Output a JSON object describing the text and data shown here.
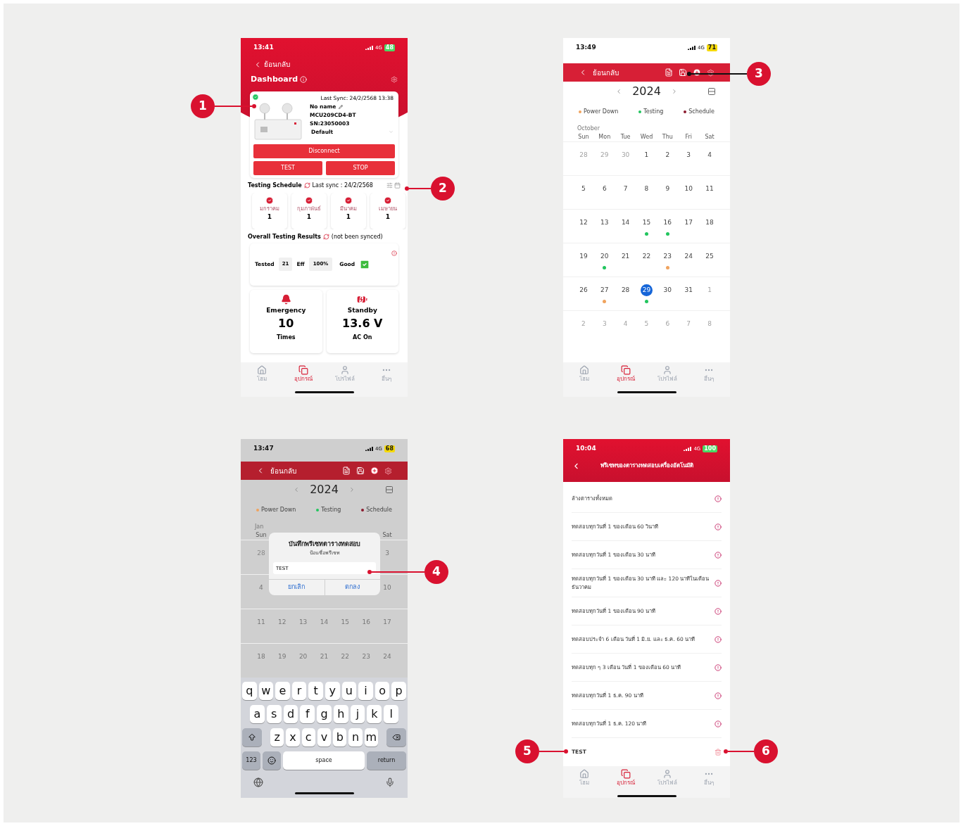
{
  "phones": [
    {
      "kind": "dashboard",
      "status_bar": {
        "time": "13:41",
        "network": "4G",
        "battery": "48",
        "low_power": false
      },
      "back_label": "ย้อนกลับ",
      "title": "Dashboard",
      "device": {
        "connected": true,
        "last_sync": "Last Sync: 24/2/2568 13:38",
        "name": "No name",
        "model": "MCU209CD4-BT",
        "serial": "SN:23050003",
        "preset": "Default"
      },
      "buttons": {
        "disconnect": "Disconnect",
        "test": "TEST",
        "stop": "STOP"
      },
      "schedule": {
        "title": "Testing Schedule",
        "last_sync": "Last sync : 24/2/2568",
        "months": [
          {
            "label": "มกราคม",
            "count": "1"
          },
          {
            "label": "กุมภาพันธ์",
            "count": "1"
          },
          {
            "label": "มีนาคม",
            "count": "1"
          },
          {
            "label": "เมษายน",
            "count": "1"
          }
        ]
      },
      "overall": {
        "title": "Overall Testing Results",
        "sync_status": "(not been synced)",
        "tested_label": "Tested",
        "tested": "21",
        "eff_label": "Eff",
        "eff": "100%",
        "result": "Good"
      },
      "stats": [
        {
          "kind": "emergency",
          "title": "Emergency",
          "value": "10",
          "unit": "Times"
        },
        {
          "kind": "standby",
          "title": "Standby",
          "value": "13.6 V",
          "unit": "AC On"
        }
      ],
      "tab_bar": [
        {
          "label": "โฮม",
          "selected": false
        },
        {
          "label": "อุปกรณ์",
          "selected": true
        },
        {
          "label": "โปรไฟล์",
          "selected": false
        },
        {
          "label": "อื่นๆ",
          "selected": false
        }
      ]
    },
    {
      "kind": "calendar",
      "status_bar": {
        "time": "13:49",
        "network": "4G",
        "battery": "71",
        "low_power": true
      },
      "back_label": "ย้อนกลับ",
      "year": "2024",
      "legend": [
        {
          "label": "Power Down",
          "color": "#f0a35e"
        },
        {
          "label": "Testing",
          "color": "#22c55e"
        },
        {
          "label": "Schedule",
          "color": "#8b1a2e"
        }
      ],
      "month": "October",
      "weekdays": [
        "Sun",
        "Mon",
        "Tue",
        "Wed",
        "Thu",
        "Fri",
        "Sat"
      ],
      "weeks": [
        [
          {
            "day": "28",
            "muted": true,
            "selected": false
          },
          {
            "day": "29",
            "muted": true,
            "selected": false
          },
          {
            "day": "30",
            "muted": true,
            "selected": false
          },
          {
            "day": "1",
            "muted": false,
            "selected": false
          },
          {
            "day": "2",
            "muted": false,
            "selected": false
          },
          {
            "day": "3",
            "muted": false,
            "selected": false
          },
          {
            "day": "4",
            "muted": false,
            "selected": false
          }
        ],
        [
          {
            "day": "5",
            "muted": false,
            "selected": false
          },
          {
            "day": "6",
            "muted": false,
            "selected": false
          },
          {
            "day": "7",
            "muted": false,
            "selected": false
          },
          {
            "day": "8",
            "muted": false,
            "selected": false
          },
          {
            "day": "9",
            "muted": false,
            "selected": false
          },
          {
            "day": "10",
            "muted": false,
            "selected": false
          },
          {
            "day": "11",
            "muted": false,
            "selected": false
          }
        ],
        [
          {
            "day": "12",
            "muted": false,
            "selected": false
          },
          {
            "day": "13",
            "muted": false,
            "selected": false
          },
          {
            "day": "14",
            "muted": false,
            "selected": false
          },
          {
            "day": "15",
            "muted": false,
            "selected": false,
            "color": "#22c55e"
          },
          {
            "day": "16",
            "muted": false,
            "selected": false,
            "color": "#22c55e"
          },
          {
            "day": "17",
            "muted": false,
            "selected": false
          },
          {
            "day": "18",
            "muted": false,
            "selected": false
          }
        ],
        [
          {
            "day": "19",
            "muted": false,
            "selected": false
          },
          {
            "day": "20",
            "muted": false,
            "selected": false,
            "color": "#22c55e"
          },
          {
            "day": "21",
            "muted": false,
            "selected": false
          },
          {
            "day": "22",
            "muted": false,
            "selected": false
          },
          {
            "day": "23",
            "muted": false,
            "selected": false,
            "color": "#f0a35e"
          },
          {
            "day": "24",
            "muted": false,
            "selected": false
          },
          {
            "day": "25",
            "muted": false,
            "selected": false
          }
        ],
        [
          {
            "day": "26",
            "muted": false,
            "selected": false
          },
          {
            "day": "27",
            "muted": false,
            "selected": false,
            "color": "#f0a35e"
          },
          {
            "day": "28",
            "muted": false,
            "selected": false
          },
          {
            "day": "29",
            "muted": false,
            "selected": true,
            "color": "#22c55e"
          },
          {
            "day": "30",
            "muted": false,
            "selected": false
          },
          {
            "day": "31",
            "muted": false,
            "selected": false
          },
          {
            "day": "1",
            "muted": true,
            "selected": false
          }
        ],
        [
          {
            "day": "2",
            "muted": true,
            "selected": false
          },
          {
            "day": "3",
            "muted": true,
            "selected": false
          },
          {
            "day": "4",
            "muted": true,
            "selected": false
          },
          {
            "day": "5",
            "muted": true,
            "selected": false
          },
          {
            "day": "6",
            "muted": true,
            "selected": false
          },
          {
            "day": "7",
            "muted": true,
            "selected": false
          },
          {
            "day": "8",
            "muted": true,
            "selected": false
          }
        ]
      ],
      "tab_bar": [
        {
          "label": "โฮม",
          "selected": false
        },
        {
          "label": "อุปกรณ์",
          "selected": true
        },
        {
          "label": "โปรไฟล์",
          "selected": false
        },
        {
          "label": "อื่นๆ",
          "selected": false
        }
      ]
    },
    {
      "kind": "calendar_dialog",
      "status_bar": {
        "time": "13:47",
        "network": "4G",
        "battery": "68",
        "low_power": true
      },
      "back_label": "ย้อนกลับ",
      "year": "2024",
      "legend": [
        {
          "label": "Power Down",
          "color": "#f0a35e"
        },
        {
          "label": "Testing",
          "color": "#22c55e"
        },
        {
          "label": "Schedule",
          "color": "#8b1a2e"
        }
      ],
      "month": "Jan",
      "weekdays": [
        "Sun",
        "Sat"
      ],
      "weeks": [
        [
          {
            "day": "28",
            "muted": true,
            "selected": false
          },
          {
            "day": "3",
            "muted": false,
            "selected": false
          }
        ],
        [
          {
            "day": "4",
            "muted": false,
            "selected": false
          },
          {
            "day": "10",
            "muted": false,
            "selected": false
          }
        ],
        [
          {
            "day": "11",
            "muted": false,
            "selected": false
          },
          {
            "day": "12",
            "muted": false,
            "selected": false
          },
          {
            "day": "13",
            "muted": false,
            "selected": false
          },
          {
            "day": "14",
            "muted": false,
            "selected": false
          },
          {
            "day": "15",
            "muted": false,
            "selected": false
          },
          {
            "day": "16",
            "muted": false,
            "selected": false
          },
          {
            "day": "17",
            "muted": false,
            "selected": false
          }
        ],
        [
          {
            "day": "18",
            "muted": false,
            "selected": false
          },
          {
            "day": "19",
            "muted": false,
            "selected": false
          },
          {
            "day": "20",
            "muted": false,
            "selected": false
          },
          {
            "day": "21",
            "muted": false,
            "selected": false
          },
          {
            "day": "22",
            "muted": false,
            "selected": false
          },
          {
            "day": "23",
            "muted": false,
            "selected": false
          },
          {
            "day": "24",
            "muted": false,
            "selected": false
          }
        ]
      ],
      "dialog": {
        "title": "บันทึกพรีเซทตารางทดสอบ",
        "subtitle": "ป้อนชื่อพรีเซท",
        "value": "TEST",
        "cancel": "ยกเลิก",
        "ok": "ตกลง"
      },
      "keyboard": {
        "rows": [
          [
            "q",
            "w",
            "e",
            "r",
            "t",
            "y",
            "u",
            "i",
            "o",
            "p"
          ],
          [
            "a",
            "s",
            "d",
            "f",
            "g",
            "h",
            "j",
            "k",
            "l"
          ],
          [
            "z",
            "x",
            "c",
            "v",
            "b",
            "n",
            "m"
          ]
        ],
        "numbers": "123",
        "space": "space",
        "return": "return"
      }
    },
    {
      "kind": "preset_list",
      "status_bar": {
        "time": "10:04",
        "network": "4G",
        "battery": "100",
        "low_power": false
      },
      "title": "พรีเซทของตารางทดสอบเครื่องอัตโนมัติ",
      "presets": [
        {
          "kind": "preset",
          "label": "ล้างตารางทั้งหมด"
        },
        {
          "kind": "preset",
          "label": "ทดสอบทุกวันที่ 1 ของเดือน 60 วินาที"
        },
        {
          "kind": "preset",
          "label": "ทดสอบทุกวันที่ 1 ของเดือน 30 นาที"
        },
        {
          "kind": "preset",
          "label": "ทดสอบทุกวันที่ 1 ของเดือน 30 นาที และ 120 นาทีในเดือนธันวาคม"
        },
        {
          "kind": "preset",
          "label": "ทดสอบทุกวันที่ 1 ของเดือน 90 นาที"
        },
        {
          "kind": "preset",
          "label": "ทดสอบประจำ 6 เดือน วันที่ 1 มิ.ย. และ ธ.ค. 60 นาที"
        },
        {
          "kind": "preset",
          "label": "ทดสอบทุก ๆ 3 เดือน วันที่ 1 ของเดือน 60 นาที"
        },
        {
          "kind": "preset",
          "label": "ทดสอบทุกวันที่ 1 ธ.ค. 90 นาที"
        },
        {
          "kind": "preset",
          "label": "ทดสอบทุกวันที่ 1 ธ.ค. 120 นาที"
        },
        {
          "kind": "custom",
          "label": "TEST"
        }
      ],
      "tab_bar": [
        {
          "label": "โฮม",
          "selected": false
        },
        {
          "label": "อุปกรณ์",
          "selected": true
        },
        {
          "label": "โปรไฟล์",
          "selected": false
        },
        {
          "label": "อื่นๆ",
          "selected": false
        }
      ]
    }
  ],
  "callouts": [
    {
      "number": "1"
    },
    {
      "number": "2"
    },
    {
      "number": "3"
    },
    {
      "number": "4"
    },
    {
      "number": "5"
    },
    {
      "number": "6"
    }
  ]
}
